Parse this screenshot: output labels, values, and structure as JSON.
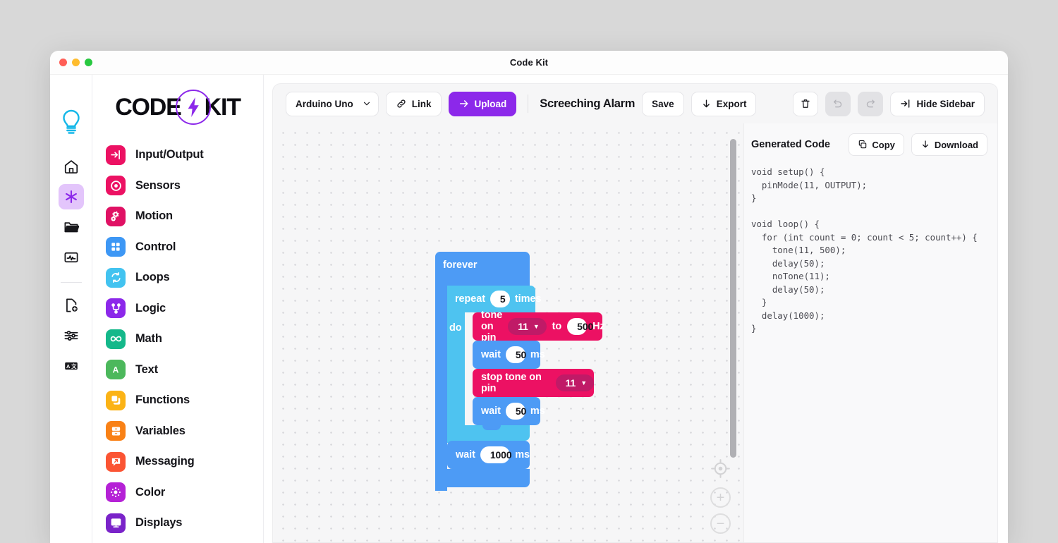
{
  "window": {
    "title": "Code Kit",
    "traffic_lights": [
      "close-red",
      "minimize-yellow",
      "maximize-green"
    ]
  },
  "brand": {
    "text_left": "CODE",
    "text_right": "KIT",
    "badge_icon": "lightning-bolt-icon",
    "accent": "#8c28ea"
  },
  "rail": {
    "logo_icon": "lightbulb-icon",
    "items": [
      {
        "icon": "home-icon",
        "name": "home",
        "active": false
      },
      {
        "icon": "blocks-icon",
        "name": "blocks",
        "active": true
      },
      {
        "icon": "folder-icon",
        "name": "projects",
        "active": false
      },
      {
        "icon": "monitor-icon",
        "name": "monitor",
        "active": false
      },
      {
        "icon": "new-file-icon",
        "name": "new-file",
        "active": false
      },
      {
        "icon": "sliders-icon",
        "name": "settings",
        "active": false
      },
      {
        "icon": "translate-icon",
        "name": "language",
        "active": false
      }
    ]
  },
  "categories": [
    {
      "label": "Input/Output",
      "icon": "input-output-icon",
      "color": "#ec1163"
    },
    {
      "label": "Sensors",
      "icon": "sensor-dot-icon",
      "color": "#ec1163"
    },
    {
      "label": "Motion",
      "icon": "gears-icon",
      "color": "#e01164"
    },
    {
      "label": "Control",
      "icon": "grid-squares-icon",
      "color": "#3d97f5"
    },
    {
      "label": "Loops",
      "icon": "loop-arrows-icon",
      "color": "#42c3f0"
    },
    {
      "label": "Logic",
      "icon": "branch-icon",
      "color": "#8c28ea"
    },
    {
      "label": "Math",
      "icon": "infinity-icon",
      "color": "#14b88a"
    },
    {
      "label": "Text",
      "icon": "letter-a-icon",
      "color": "#4cb85c"
    },
    {
      "label": "Functions",
      "icon": "layers-icon",
      "color": "#fbb316"
    },
    {
      "label": "Variables",
      "icon": "drawers-icon",
      "color": "#f98116"
    },
    {
      "label": "Messaging",
      "icon": "message-send-icon",
      "color": "#fb5433"
    },
    {
      "label": "Color",
      "icon": "brightness-icon",
      "color": "#b521d6"
    },
    {
      "label": "Displays",
      "icon": "display-icon",
      "color": "#7a23c9"
    }
  ],
  "toolbar": {
    "board_select": {
      "value": "Arduino Uno",
      "icon": "chevron-down-icon"
    },
    "link_label": "Link",
    "link_icon": "chain-link-icon",
    "upload_label": "Upload",
    "upload_icon": "arrow-right-icon",
    "project_title": "Screeching Alarm",
    "save_label": "Save",
    "export_label": "Export",
    "export_icon": "download-arrow-icon",
    "delete_icon": "trash-icon",
    "undo_icon": "undo-icon",
    "redo_icon": "redo-icon",
    "hide_sidebar_label": "Hide Sidebar",
    "hide_sidebar_icon": "collapse-right-icon"
  },
  "canvas": {
    "zoom_center_icon": "crosshair-icon",
    "zoom_in_label": "+",
    "zoom_out_label": "−",
    "scrollbar": "vertical-scrollbar"
  },
  "blocks": {
    "forever_label": "forever",
    "repeat_label": "repeat",
    "repeat_count": "5",
    "times_label": "times",
    "do_label": "do",
    "tone_label": "tone on pin",
    "tone_pin": "11",
    "tone_to": "to",
    "tone_freq": "500",
    "tone_unit": "Hz",
    "wait1_label": "wait",
    "wait1_value": "50",
    "wait1_unit": "ms",
    "stoptone_label": "stop tone on pin",
    "stoptone_pin": "11",
    "wait2_label": "wait",
    "wait2_value": "50",
    "wait2_unit": "ms",
    "wait3_label": "wait",
    "wait3_value": "1000",
    "wait3_unit": "ms",
    "colors": {
      "forever": "#4d9bf5",
      "repeat": "#4ec3f0",
      "tone": "#ec1163",
      "wait": "#4d9bf5",
      "dropdown": "#c01a67"
    }
  },
  "code_panel": {
    "title": "Generated Code",
    "copy_label": "Copy",
    "copy_icon": "copy-icon",
    "download_label": "Download",
    "download_icon": "download-arrow-icon",
    "code": "void setup() {\n  pinMode(11, OUTPUT);\n}\n\nvoid loop() {\n  for (int count = 0; count < 5; count++) {\n    tone(11, 500);\n    delay(50);\n    noTone(11);\n    delay(50);\n  }\n  delay(1000);\n}"
  }
}
